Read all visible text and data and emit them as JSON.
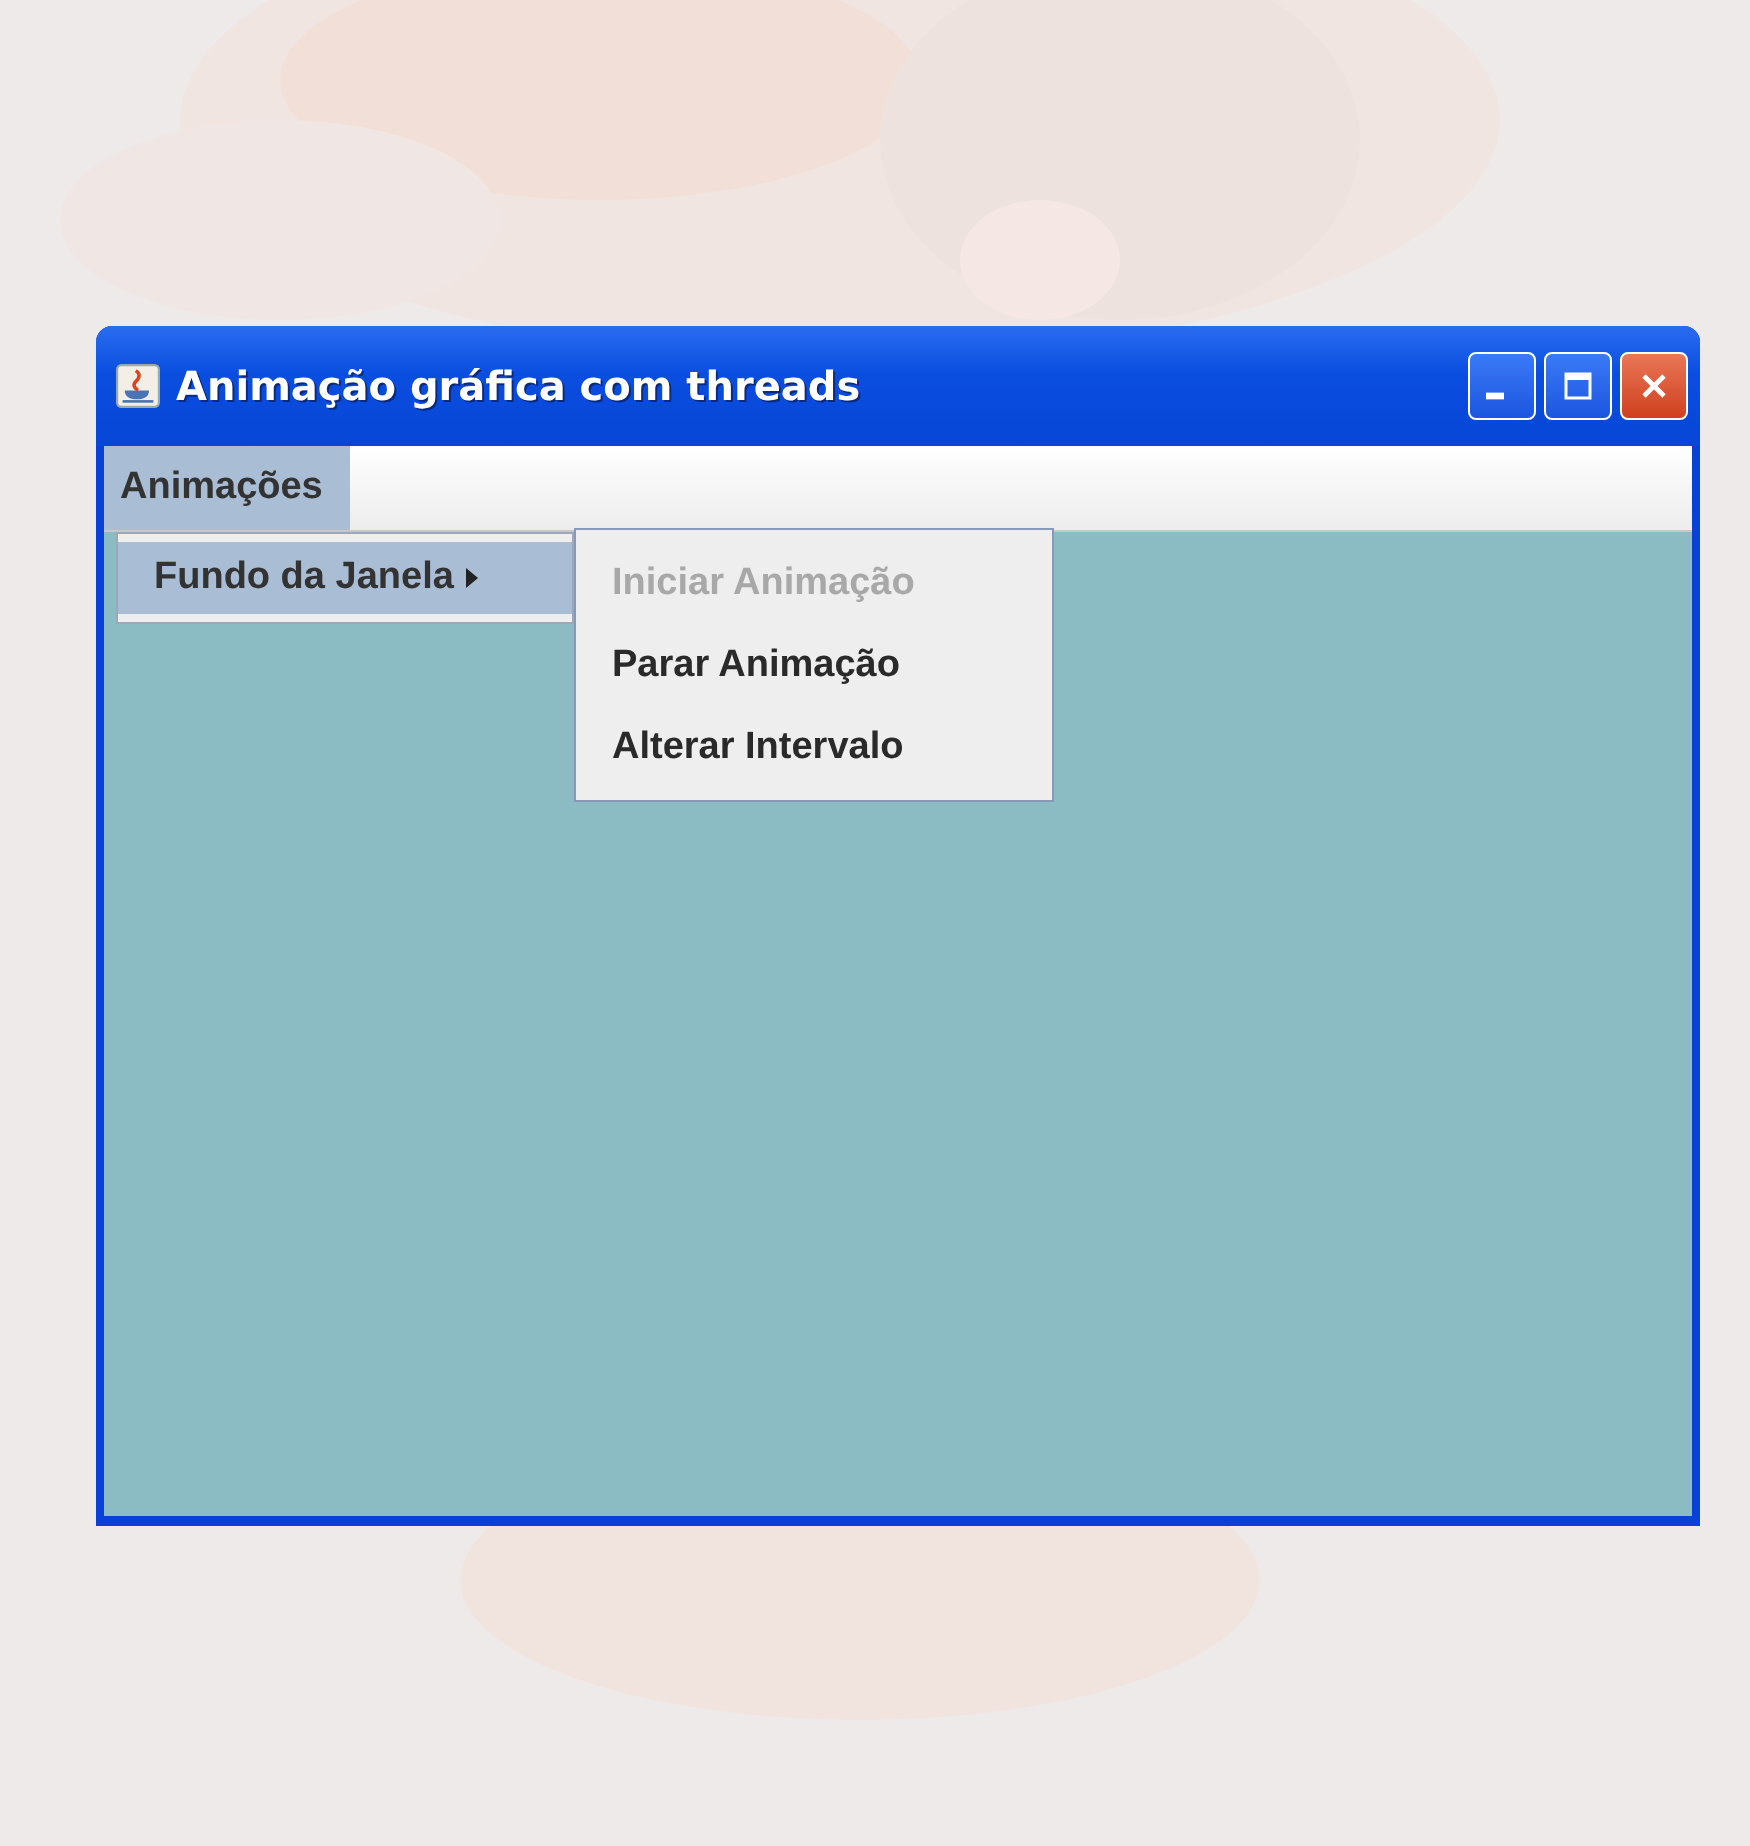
{
  "window": {
    "title": "Animação gráfica com threads"
  },
  "menu_bar": [
    {
      "label": "Animações",
      "selected": true
    }
  ],
  "menu": [
    {
      "label": "Fundo da Janela",
      "selected": true,
      "has_submenu": true
    }
  ],
  "submenu": [
    {
      "label": "Iniciar Animação",
      "disabled": true
    },
    {
      "label": "Parar Animação",
      "disabled": false
    },
    {
      "label": "Alterar Intervalo",
      "disabled": false
    }
  ]
}
